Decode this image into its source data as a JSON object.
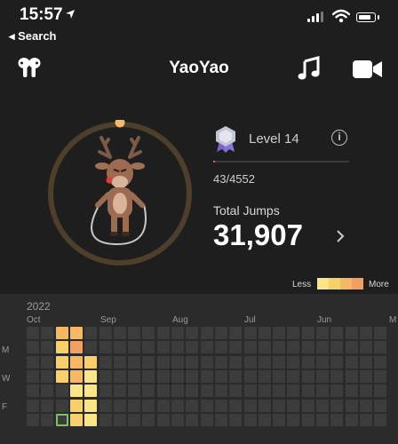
{
  "status_bar": {
    "time": "15:57",
    "back_label": "◂ Search"
  },
  "header": {
    "title": "YaoYao"
  },
  "level": {
    "label": "Level 14",
    "progress_text": "43/4552",
    "progress_fraction": 0.0094
  },
  "stats": {
    "total_label": "Total Jumps",
    "total_value": "31,907"
  },
  "legend": {
    "less": "Less",
    "more": "More",
    "colors": [
      "#fae58b",
      "#f8d06a",
      "#f5b863",
      "#f0a060"
    ]
  },
  "heatmap": {
    "year": "2022",
    "months": [
      "Oct",
      "Sep",
      "Aug",
      "Jul",
      "Jun",
      "M"
    ],
    "days": [
      "M",
      "W",
      "F"
    ],
    "empty_color": "#3c3c3c",
    "columns": 25,
    "rows": 7,
    "filled": [
      {
        "col": 2,
        "row": 0,
        "color": "#f5b863"
      },
      {
        "col": 3,
        "row": 0,
        "color": "#f5b863"
      },
      {
        "col": 2,
        "row": 1,
        "color": "#f8d06a"
      },
      {
        "col": 3,
        "row": 1,
        "color": "#f0a060"
      },
      {
        "col": 2,
        "row": 2,
        "color": "#f8d06a"
      },
      {
        "col": 3,
        "row": 2,
        "color": "#f5b863"
      },
      {
        "col": 4,
        "row": 2,
        "color": "#f8d06a"
      },
      {
        "col": 2,
        "row": 3,
        "color": "#f8d06a"
      },
      {
        "col": 3,
        "row": 3,
        "color": "#f5b863"
      },
      {
        "col": 4,
        "row": 3,
        "color": "#fae58b"
      },
      {
        "col": 3,
        "row": 4,
        "color": "#fae58b"
      },
      {
        "col": 4,
        "row": 4,
        "color": "#fae58b"
      },
      {
        "col": 3,
        "row": 5,
        "color": "#f8d06a"
      },
      {
        "col": 4,
        "row": 5,
        "color": "#fae58b"
      },
      {
        "col": 3,
        "row": 6,
        "color": "#f8d06a"
      },
      {
        "col": 4,
        "row": 6,
        "color": "#fae58b"
      }
    ],
    "today": {
      "col": 2,
      "row": 6
    }
  }
}
